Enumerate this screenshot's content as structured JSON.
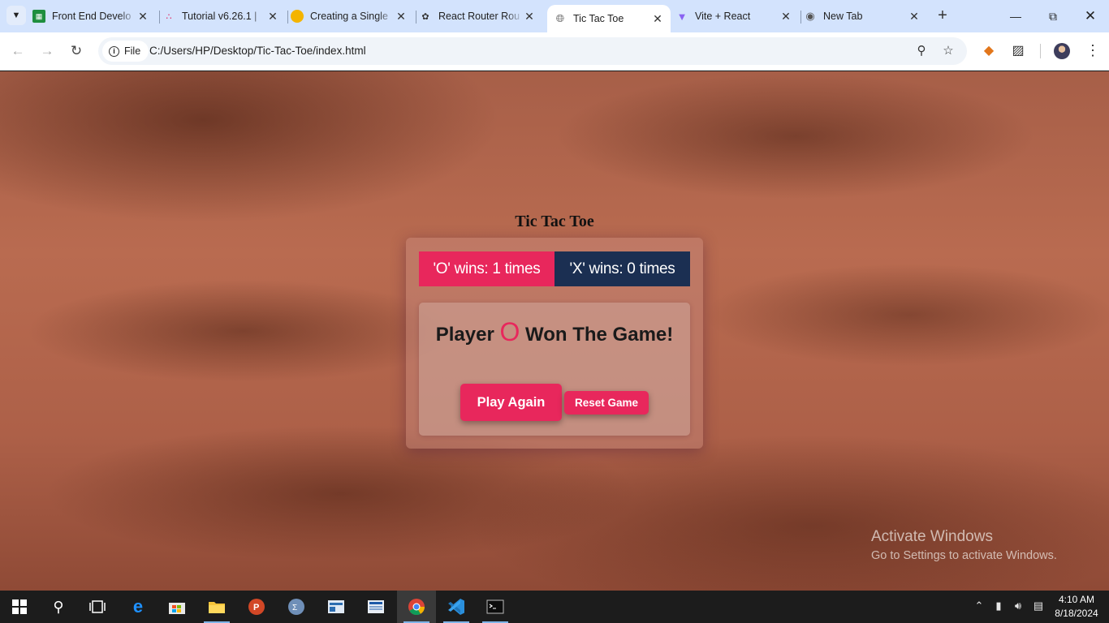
{
  "browser": {
    "tabs": [
      {
        "title": "Front End Develo",
        "icon": "sheets-icon",
        "color": "#1e8e3e",
        "active": false
      },
      {
        "title": "Tutorial v6.26.1 |",
        "icon": "react-router-icon",
        "color": "#e0245e",
        "active": false
      },
      {
        "title": "Creating a Single",
        "icon": "medium-icon",
        "color": "#f4b400",
        "active": false
      },
      {
        "title": "React Router Rou",
        "icon": "openai-icon",
        "color": "#333333",
        "active": false
      },
      {
        "title": "Tic Tac Toe",
        "icon": "globe-icon",
        "color": "#555555",
        "active": true
      },
      {
        "title": "Vite + React",
        "icon": "vite-icon",
        "color": "#8a63f2",
        "active": false
      },
      {
        "title": "New Tab",
        "icon": "chrome-icon",
        "color": "#555555",
        "active": false
      }
    ],
    "address": {
      "chip_label": "File",
      "url": "C:/Users/HP/Desktop/Tic-Tac-Toe/index.html"
    }
  },
  "game": {
    "title": "Tic Tac Toe",
    "score_o": "'O' wins: 1 times",
    "score_x": "'X' wins: 0 times",
    "message_prefix": "Player",
    "winner_mark": "O",
    "message_suffix": "Won The Game!",
    "play_again_label": "Play Again",
    "reset_label": "Reset Game",
    "accent_color": "#e8275c",
    "x_color": "#1b2f52"
  },
  "watermark": {
    "line1": "Activate Windows",
    "line2": "Go to Settings to activate Windows."
  },
  "taskbar": {
    "apps": [
      "start-icon",
      "search-icon",
      "task-view-icon",
      "edge-icon",
      "store-icon",
      "file-explorer-icon",
      "powerpoint-icon",
      "app-icon",
      "app-icon-2",
      "app-icon-3",
      "chrome-icon",
      "vscode-icon",
      "terminal-icon"
    ],
    "time": "4:10 AM",
    "date": "8/18/2024"
  }
}
